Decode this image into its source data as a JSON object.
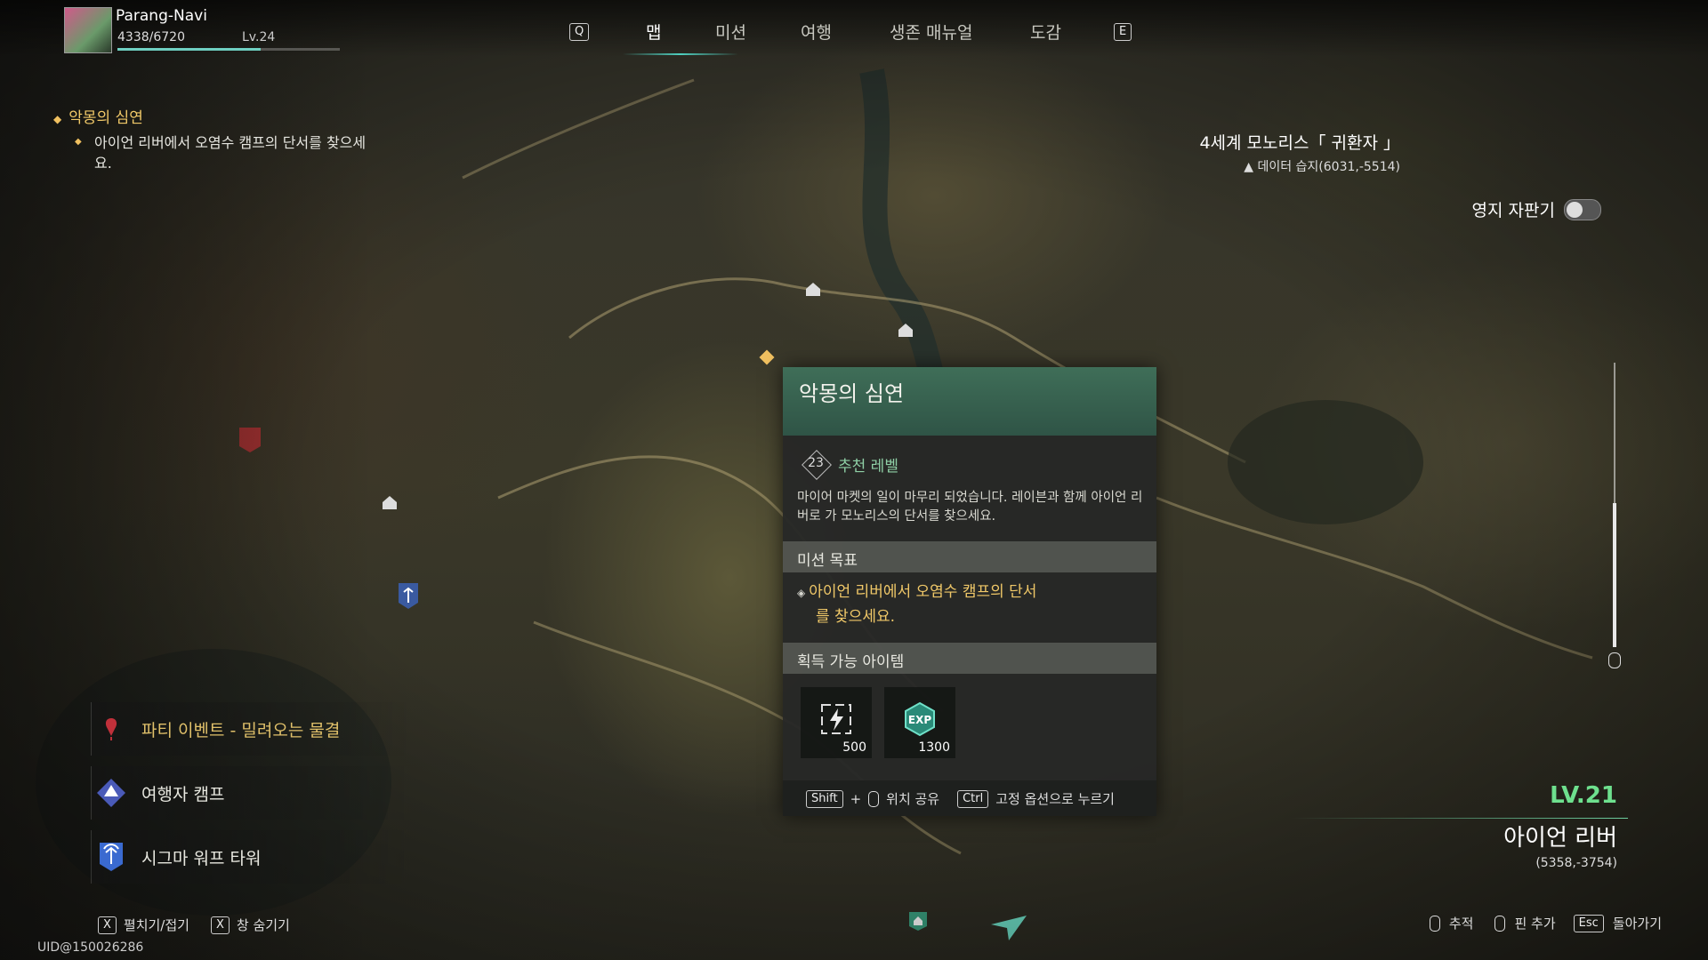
{
  "player": {
    "name": "Parang-Navi",
    "exp": "4338/6720",
    "level": "Lv.24",
    "exp_progress": 0.645
  },
  "nav": {
    "prev_key": "Q",
    "next_key": "E",
    "tabs": [
      {
        "label": "맵",
        "active": true
      },
      {
        "label": "미션",
        "active": false
      },
      {
        "label": "여행",
        "active": false
      },
      {
        "label": "생존 매뉴얼",
        "active": false
      },
      {
        "label": "도감",
        "active": false
      }
    ]
  },
  "tracked_quest": {
    "title": "악몽의 심연",
    "objective": "아이언 리버에서 오염수 캠프의 단서를 찾으세요."
  },
  "world": {
    "name": "4세계 모노리스「 귀환자 」",
    "position": "데이터 습지(6031,-5514)",
    "toggle_label": "영지 자판기",
    "toggle_on": false
  },
  "zoom_level": 0.5,
  "popup": {
    "title": "악몽의 심연",
    "recommended_level": "23",
    "recommended_label": "추천 레벨",
    "description": "마이어 마켓의 일이 마무리 되었습니다. 레이븐과 함께 아이언 리버로 가 모노리스의 단서를 찾으세요.",
    "objective_header": "미션 목표",
    "objective_line1": "아이언 리버에서 오염수 캠프의 단서",
    "objective_line2": "를 찾으세요.",
    "rewards_header": "획득 가능 아이템",
    "rewards": [
      {
        "icon": "energy-icon",
        "count": "500"
      },
      {
        "icon": "exp-icon",
        "count": "1300"
      }
    ],
    "footer": {
      "shift_key": "Shift",
      "plus": "+",
      "share_label": "위치 공유",
      "ctrl_key": "Ctrl",
      "pin_label": "고정 옵션으로 누르기"
    }
  },
  "legend": [
    {
      "icon": "alert-pin-icon",
      "label": "파티 이벤트 - 밀려오는 물결",
      "color": "#e0c06a"
    },
    {
      "icon": "camp-icon",
      "label": "여행자 캠프",
      "color": "#f0f0e8"
    },
    {
      "icon": "tower-icon",
      "label": "시그마 워프 타워",
      "color": "#f0f0e8"
    }
  ],
  "bottom_left": {
    "expand_key": "X",
    "expand_label": "펼치기/접기",
    "hide_key": "X",
    "hide_label": "창 숨기기",
    "uid": "UID@150026286"
  },
  "area": {
    "level": "LV.21",
    "name": "아이언 리버",
    "coords": "(5358,-3754)"
  },
  "bottom_right": {
    "track_label": "추적",
    "pin_label": "핀 추가",
    "back_key": "Esc",
    "back_label": "돌아가기"
  },
  "colors": {
    "accent_teal": "#4fd0c0",
    "quest_gold": "#f0c868",
    "area_green": "#6ee08e",
    "popup_header": "#3f6e58"
  }
}
